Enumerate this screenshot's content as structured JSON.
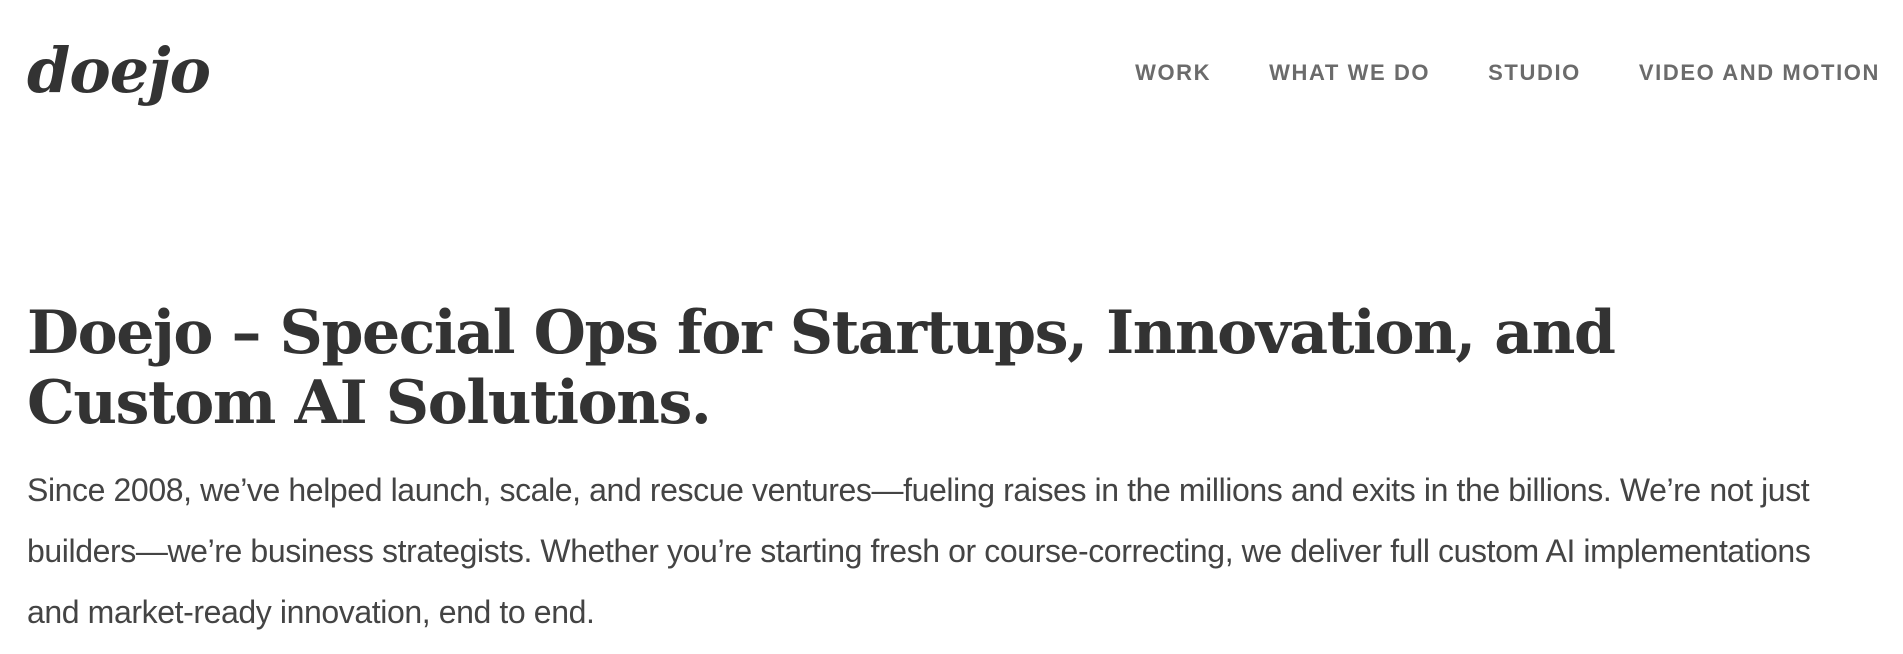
{
  "header": {
    "logo_text": "doejo",
    "nav": [
      {
        "label": "WORK"
      },
      {
        "label": "WHAT WE DO"
      },
      {
        "label": "STUDIO"
      },
      {
        "label": "VIDEO AND MOTION"
      }
    ]
  },
  "hero": {
    "title": "Doejo – Special Ops for Startups, Innovation, and Custom AI Solutions.",
    "body": "Since 2008, we’ve helped launch, scale, and rescue ventures—fueling raises in the millions and exits in the billions. We’re not just builders—we’re business strategists. Whether you’re starting fresh or course-correcting, we deliver full custom AI implementations and market-ready innovation, end to end."
  },
  "colors": {
    "text": "#333333",
    "nav_text": "#6b6b6b",
    "body_text": "#444444",
    "background": "#ffffff"
  }
}
